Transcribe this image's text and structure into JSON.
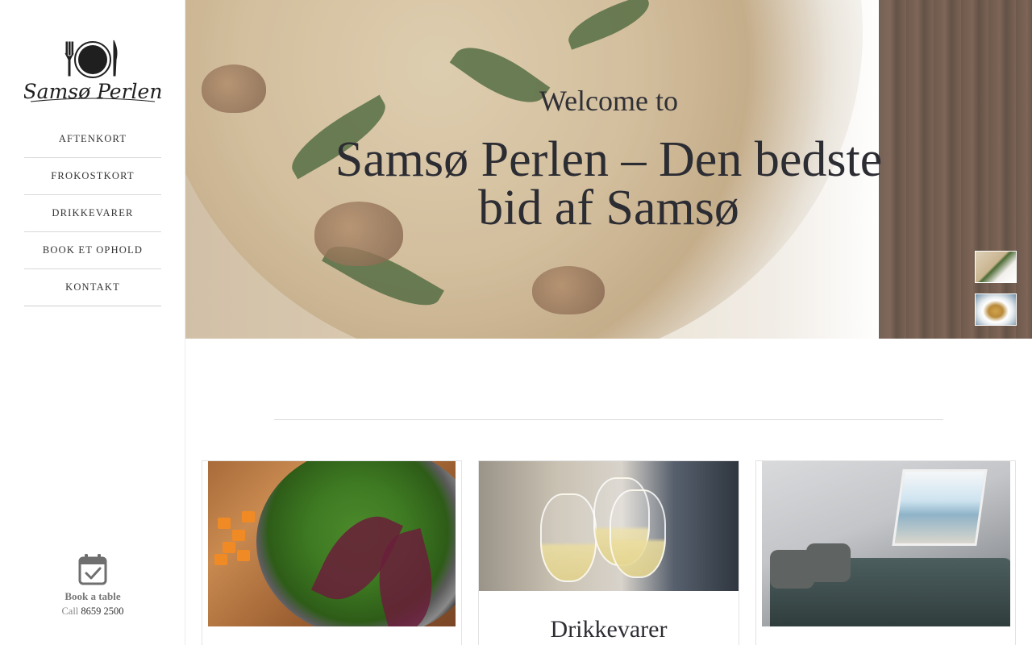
{
  "brand": {
    "logo_text": "Samsø Perlen"
  },
  "nav": {
    "items": [
      {
        "label": "AFTENKORT"
      },
      {
        "label": "FROKOSTKORT"
      },
      {
        "label": "DRIKKEVARER"
      },
      {
        "label": "BOOK ET OPHOLD"
      },
      {
        "label": "KONTAKT"
      }
    ]
  },
  "booking": {
    "label": "Book a table",
    "call_prefix": "Call",
    "phone": "8659 2500",
    "icon": "calendar-check-icon"
  },
  "hero": {
    "welcome": "Welcome to",
    "title": "Samsø Perlen – Den bedste bid af Samsø",
    "slides": [
      {
        "name": "pasta-thumbnail"
      },
      {
        "name": "soup-thumbnail"
      }
    ]
  },
  "cards": [
    {
      "name": "greens-card",
      "heading": ""
    },
    {
      "name": "drinks-card",
      "heading": "Drikkevarer"
    },
    {
      "name": "room-card",
      "heading": ""
    }
  ],
  "colors": {
    "text": "#2c2c33",
    "nav_border": "#d9d9d9",
    "muted": "#777777"
  }
}
